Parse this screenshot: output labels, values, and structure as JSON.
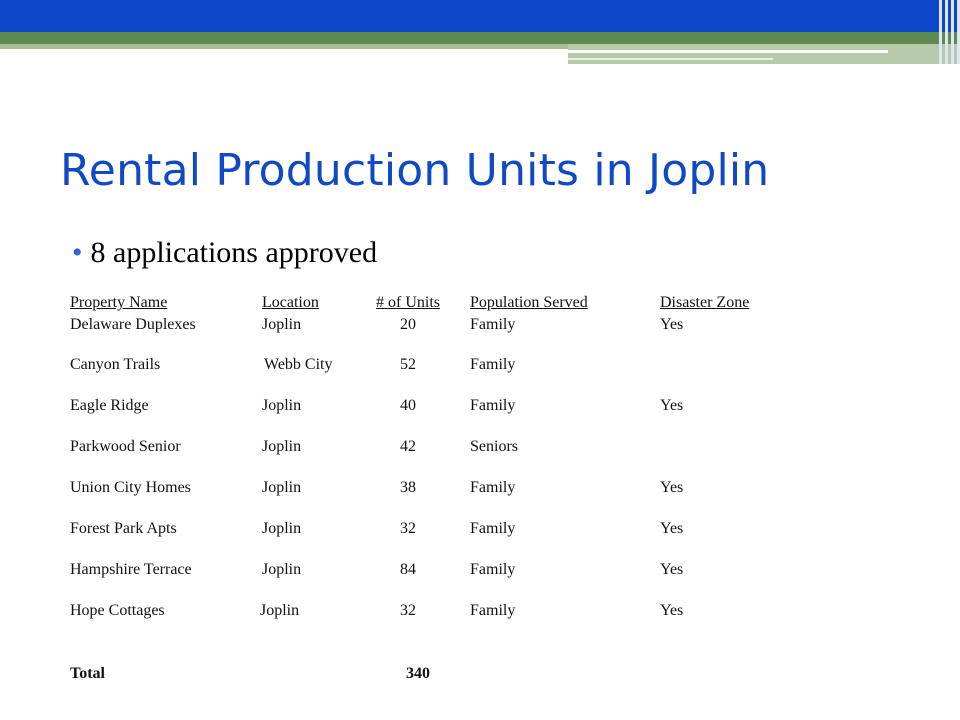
{
  "slide": {
    "title": "Rental Production Units in Joplin",
    "bullet": "8 applications approved"
  },
  "table": {
    "headers": [
      "Property Name",
      "Location",
      "# of Units",
      "Population Served",
      "Disaster Zone"
    ],
    "rows": [
      [
        "Delaware Duplexes",
        "Joplin",
        "20",
        "Family",
        "Yes"
      ],
      [
        "Canyon Trails",
        "Webb City",
        "52",
        "Family",
        ""
      ],
      [
        "Eagle Ridge",
        "Joplin",
        "40",
        "Family",
        "Yes"
      ],
      [
        "Parkwood Senior",
        "Joplin",
        "42",
        "Seniors",
        ""
      ],
      [
        "Union City Homes",
        "Joplin",
        "38",
        "Family",
        "Yes"
      ],
      [
        "Forest Park Apts",
        "Joplin",
        "32",
        "Family",
        "Yes"
      ],
      [
        "Hampshire Terrace",
        "Joplin",
        "84",
        "Family",
        "Yes"
      ],
      [
        "Hope Cottages",
        "Joplin",
        "32",
        "Family",
        "Yes"
      ]
    ],
    "total_label": "Total",
    "total_units": "340"
  },
  "colors": {
    "title": "#1049c5",
    "top_bar_blue": "#0a47c9",
    "top_bar_green": "#5f8a4e"
  }
}
